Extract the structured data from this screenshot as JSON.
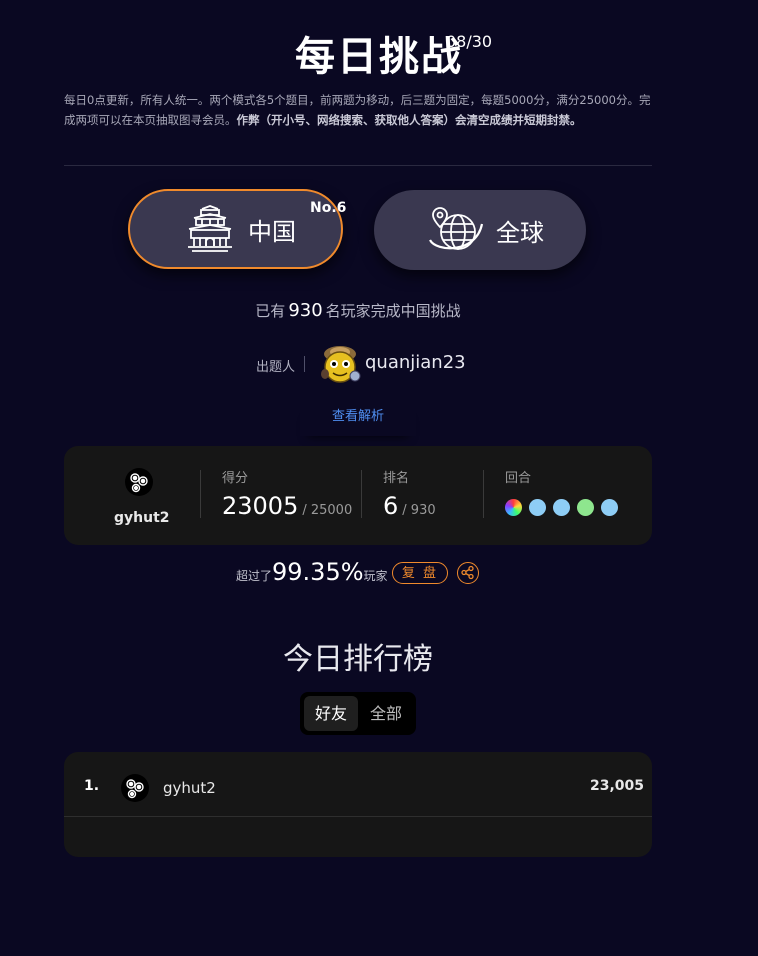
{
  "header": {
    "title": "每日挑战",
    "date": "08/30",
    "description_plain": "每日0点更新，所有人统一。两个模式各5个题目，前两题为移动，后三题为固定，每题5000分，满分25000分。完成两项可以在本页抽取图寻会员。",
    "description_bold": "作弊（开小号、网络搜索、获取他人答案）会清空成绩并短期封禁。"
  },
  "modes": {
    "china": {
      "label": "中国",
      "icon": "temple-icon",
      "rank_badge": "No.6",
      "accent": "#f08a2c"
    },
    "global": {
      "label": "全球",
      "icon": "globe-pin-icon"
    }
  },
  "played": {
    "prefix": "已有",
    "count": "930",
    "suffix": "名玩家完成中国挑战"
  },
  "author": {
    "label": "出题人",
    "name": "quanjian23"
  },
  "analysis_link": "查看解析",
  "score_card": {
    "user_name": "gyhut2",
    "score_label": "得分",
    "score_value": "23005",
    "score_max": "/ 25000",
    "rank_label": "排名",
    "rank_value": "6",
    "rank_max": "/ 930",
    "rounds_label": "回合",
    "round_colors": [
      "rainbow",
      "#8ecdf5",
      "#8ecdf5",
      "#8ee68e",
      "#8ecdf5"
    ]
  },
  "beat": {
    "prefix": "超过了",
    "percent": "99.35%",
    "suffix": "玩家",
    "review_label": "复 盘"
  },
  "leaderboard": {
    "title": "今日排行榜",
    "tabs": [
      "好友",
      "全部"
    ],
    "active_tab": "好友",
    "rows": [
      {
        "rank": "1.",
        "name": "gyhut2",
        "score": "23,005"
      }
    ]
  }
}
